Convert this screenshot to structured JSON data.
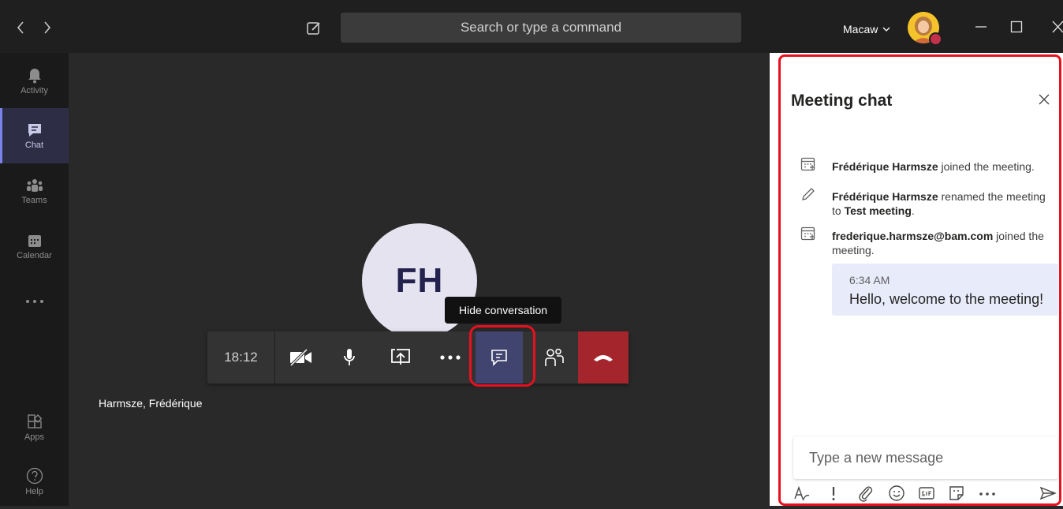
{
  "top_bar": {
    "search_placeholder": "Search or type a command",
    "org_name": "Macaw"
  },
  "rail": {
    "items": [
      {
        "label": "Activity",
        "icon": "bell-icon"
      },
      {
        "label": "Chat",
        "icon": "chat-icon",
        "active": true
      },
      {
        "label": "Teams",
        "icon": "teams-icon"
      },
      {
        "label": "Calendar",
        "icon": "calendar-icon"
      },
      {
        "label": "",
        "icon": "more-icon"
      },
      {
        "label": "Apps",
        "icon": "apps-icon"
      },
      {
        "label": "Help",
        "icon": "help-icon"
      }
    ]
  },
  "stage": {
    "avatar_initials": "FH",
    "participant_name": "Harmsze, Frédérique",
    "tooltip": "Hide conversation",
    "timer": "18:12"
  },
  "chat_panel": {
    "title": "Meeting chat",
    "events": [
      {
        "actor": "Frédérique Harmsze",
        "text": "joined the meeting."
      },
      {
        "actor": "Frédérique Harmsze",
        "text": "renamed the meeting to",
        "target": "Test meeting",
        "suffix": "."
      },
      {
        "actor": "frederique.harmsze@bam.com",
        "text": "joined the meeting."
      }
    ],
    "message": {
      "time": "6:34 AM",
      "text": "Hello, welcome to the meeting!"
    },
    "composer_placeholder": "Type a new message"
  },
  "colors": {
    "accent": "#7b83eb",
    "hangup": "#a4262c",
    "highlight_box": "#e8101e",
    "bubble": "#e8ebfa"
  }
}
